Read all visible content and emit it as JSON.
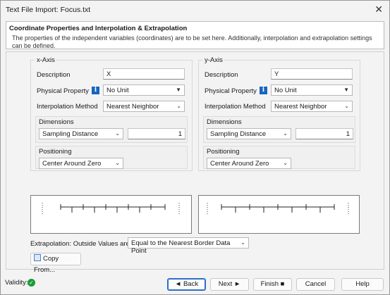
{
  "window": {
    "title": "Text File Import: Focus.txt",
    "close_glyph": "✕"
  },
  "header": {
    "title": "Coordinate Properties and Interpolation & Extrapolation",
    "description": "The properties of the independent variables (coordinates) are to be set here. Additionally, interpolation and extrapolation settings can be defined."
  },
  "x_axis": {
    "title": "x-Axis",
    "description_label": "Description",
    "description_value": "X",
    "physical_property_label": "Physical Property",
    "physical_property_value": "No Unit",
    "interpolation_label": "Interpolation Method",
    "interpolation_value": "Nearest Neighbor",
    "dimensions_label": "Dimensions",
    "dimensions_mode": "Sampling Distance",
    "dimensions_value": "1",
    "positioning_label": "Positioning",
    "positioning_value": "Center Around Zero"
  },
  "y_axis": {
    "title": "y-Axis",
    "description_label": "Description",
    "description_value": "Y",
    "physical_property_label": "Physical Property",
    "physical_property_value": "No Unit",
    "interpolation_label": "Interpolation Method",
    "interpolation_value": "Nearest Neighbor",
    "dimensions_label": "Dimensions",
    "dimensions_mode": "Sampling Distance",
    "dimensions_value": "1",
    "positioning_label": "Positioning",
    "positioning_value": "Center Around Zero"
  },
  "extrapolation": {
    "label": "Extrapolation: Outside Values are",
    "value": "Equal to the Nearest Border Data Point"
  },
  "copy_from_label": "Copy From...",
  "info_glyph": "i",
  "footer": {
    "validity_label": "Validity:",
    "validity_glyph": "✓",
    "back_label": "◄ Back",
    "next_label": "Next ►",
    "finish_label": "Finish ■",
    "cancel_label": "Cancel",
    "help_label": "Help"
  },
  "colors": {
    "accent": "#2d6fc6",
    "info": "#1565c0",
    "valid": "#1a9b36"
  },
  "icons": [
    "close-icon",
    "info-icon",
    "chevron-down-icon",
    "copy-icon",
    "check-icon"
  ]
}
